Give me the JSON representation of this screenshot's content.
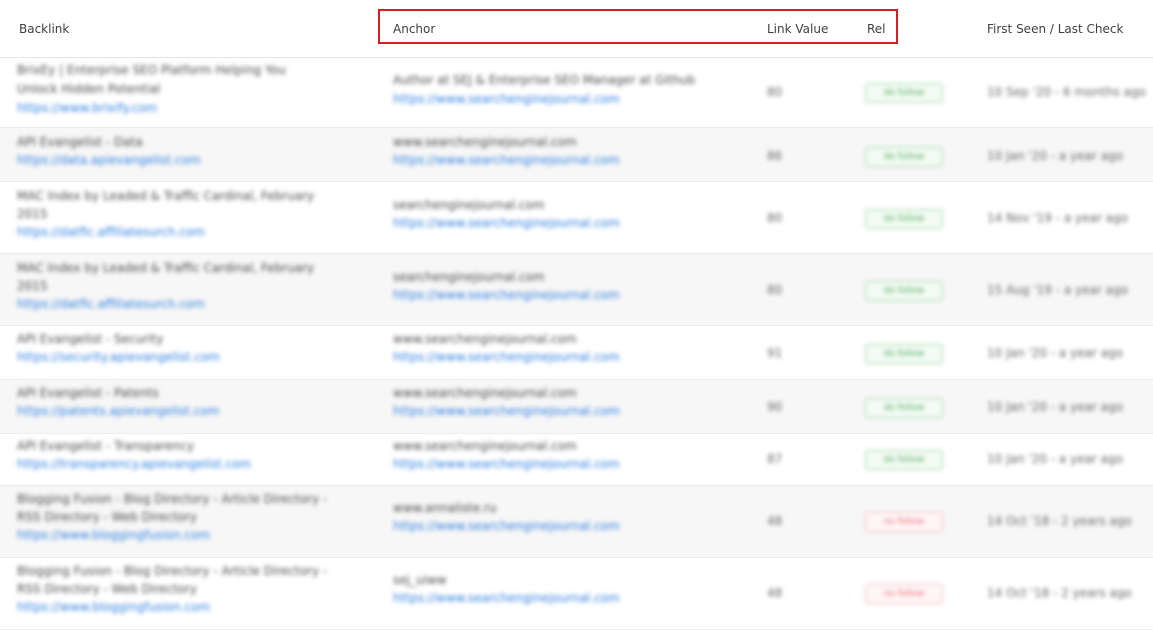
{
  "headers": {
    "backlink": "Backlink",
    "anchor": "Anchor",
    "link_value": "Link Value",
    "rel": "Rel",
    "first_seen": "First Seen / Last Check"
  },
  "colors": {
    "highlight": "#d42020",
    "link": "#2f7fe0",
    "follow": "#4da85a",
    "nofollow": "#e06873"
  },
  "rows": [
    {
      "title_lines": [
        "BrixEy | Enterprise SEO Platform Helping You",
        "Unlock Hidden Potential"
      ],
      "url": "https://www.brixify.com",
      "anchor": "Author at SEJ & Enterprise SEO Manager at Github",
      "anchor_url": "https://www.searchenginejournal.com",
      "link_value": "80",
      "rel": "do follow",
      "rel_type": "follow",
      "date": "10 Sep '20 - 6 months ago"
    },
    {
      "title_lines": [
        "API Evangelist - Data"
      ],
      "url": "https://data.apievangelist.com",
      "anchor": "www.searchenginejournal.com",
      "anchor_url": "https://www.searchenginejournal.com",
      "link_value": "86",
      "rel": "do follow",
      "rel_type": "follow",
      "date": "10 Jan '20 - a year ago"
    },
    {
      "title_lines": [
        "MAC Index by Leaded & Traffic Cardinal, February",
        "2015"
      ],
      "url": "https://datfic.affiliatesurch.com",
      "anchor": "searchenginejournal.com",
      "anchor_url": "https://www.searchenginejournal.com",
      "link_value": "80",
      "rel": "do follow",
      "rel_type": "follow",
      "date": "14 Nov '19 - a year ago"
    },
    {
      "title_lines": [
        "MAC Index by Leaded & Traffic Cardinal, February",
        "2015"
      ],
      "url": "https://datfic.affiliatesurch.com",
      "anchor": "searchenginejournal.com",
      "anchor_url": "https://www.searchenginejournal.com",
      "link_value": "80",
      "rel": "do follow",
      "rel_type": "follow",
      "date": "15 Aug '19 - a year ago"
    },
    {
      "title_lines": [
        "API Evangelist - Security"
      ],
      "url": "https://security.apievangelist.com",
      "anchor": "www.searchenginejournal.com",
      "anchor_url": "https://www.searchenginejournal.com",
      "link_value": "91",
      "rel": "do follow",
      "rel_type": "follow",
      "date": "10 Jan '20 - a year ago"
    },
    {
      "title_lines": [
        "API Evangelist - Patents"
      ],
      "url": "https://patents.apievangelist.com",
      "anchor": "www.searchenginejournal.com",
      "anchor_url": "https://www.searchenginejournal.com",
      "link_value": "90",
      "rel": "do follow",
      "rel_type": "follow",
      "date": "10 Jan '20 - a year ago"
    },
    {
      "title_lines": [
        "API Evangelist - Transparency"
      ],
      "url": "https://transparency.apievangelist.com",
      "anchor": "www.searchenginejournal.com",
      "anchor_url": "https://www.searchenginejournal.com",
      "link_value": "87",
      "rel": "do follow",
      "rel_type": "follow",
      "date": "10 Jan '20 - a year ago"
    },
    {
      "title_lines": [
        "Blogging Fusion - Blog Directory - Article Directory -",
        "RSS Directory - Web Directory"
      ],
      "url": "https://www.bloggingfusion.com",
      "anchor": "www.annaliste.ru",
      "anchor_url": "https://www.searchenginejournal.com",
      "link_value": "48",
      "rel": "no follow",
      "rel_type": "nofollow",
      "date": "14 Oct '18 - 2 years ago"
    },
    {
      "title_lines": [
        "Blogging Fusion - Blog Directory - Article Directory -",
        "RSS Directory - Web Directory"
      ],
      "url": "https://www.bloggingfusion.com",
      "anchor": "sej_uiww",
      "anchor_url": "https://www.searchenginejournal.com",
      "link_value": "48",
      "rel": "no follow",
      "rel_type": "nofollow",
      "date": "14 Oct '18 - 2 years ago"
    }
  ]
}
